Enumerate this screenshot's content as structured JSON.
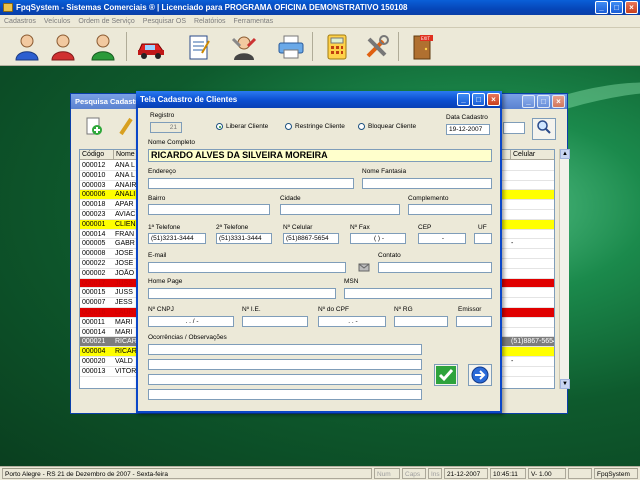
{
  "app": {
    "title": "FpqSystem - Sistemas Comerciais ® | Licenciado para PROGRAMA OFICINA DEMONSTRATIVO 150108",
    "menu": [
      "Cadastros",
      "Veículos",
      "Ordem de Serviço",
      "Pesquisar OS",
      "Relatórios",
      "Ferramentas"
    ],
    "toolbar_icons": [
      "user-blue-icon",
      "user-red-icon",
      "user-green-icon",
      "car-icon",
      "notepad-icon",
      "tools-person-icon",
      "printer-icon",
      "calculator-icon",
      "wrench-icon",
      "exit-icon"
    ]
  },
  "search_window": {
    "title": "Pesquisa Cadastro",
    "columns": [
      "Código",
      "Nome",
      "Celular"
    ],
    "rows": [
      {
        "code": "000012",
        "name": "ANA L",
        "cel": "",
        "style": ""
      },
      {
        "code": "000010",
        "name": "ANA L",
        "cel": "",
        "style": ""
      },
      {
        "code": "000003",
        "name": "ANAIR",
        "cel": "",
        "style": ""
      },
      {
        "code": "000006",
        "name": "ANALI",
        "cel": "",
        "style": "yellow"
      },
      {
        "code": "000018",
        "name": "APAR",
        "cel": "",
        "style": ""
      },
      {
        "code": "000023",
        "name": "AVIAC",
        "cel": "",
        "style": ""
      },
      {
        "code": "000001",
        "name": "CLIEN",
        "cel": "",
        "style": "yellow"
      },
      {
        "code": "000014",
        "name": "FRAN",
        "cel": "",
        "style": ""
      },
      {
        "code": "000005",
        "name": "GABR",
        "cel": "-",
        "style": ""
      },
      {
        "code": "000008",
        "name": "JOSE",
        "cel": "",
        "style": ""
      },
      {
        "code": "000022",
        "name": "JOSE",
        "cel": "",
        "style": ""
      },
      {
        "code": "000002",
        "name": "JOÃO",
        "cel": "",
        "style": ""
      },
      {
        "code": "000017",
        "name": "JUSS",
        "cel": "",
        "style": "red"
      },
      {
        "code": "000015",
        "name": "JUSS",
        "cel": "",
        "style": ""
      },
      {
        "code": "000007",
        "name": "JESS",
        "cel": "",
        "style": ""
      },
      {
        "code": "000016",
        "name": "LAUR",
        "cel": "",
        "style": "red"
      },
      {
        "code": "000011",
        "name": "MARI",
        "cel": "",
        "style": ""
      },
      {
        "code": "000014",
        "name": "MARI",
        "cel": "",
        "style": ""
      },
      {
        "code": "000021",
        "name": "RICAR",
        "cel": "(51)8867-5654",
        "style": "sel"
      },
      {
        "code": "000004",
        "name": "RICAR",
        "cel": "",
        "style": "yellow"
      },
      {
        "code": "000020",
        "name": "VALD",
        "cel": "-",
        "style": ""
      },
      {
        "code": "000013",
        "name": "VITOR",
        "cel": "",
        "style": ""
      }
    ]
  },
  "dialog": {
    "title": "Tela Cadastro de Clientes",
    "registro_label": "Registro",
    "registro_value": "21",
    "radios": [
      {
        "label": "Liberar Cliente",
        "checked": true
      },
      {
        "label": "Restringe Cliente",
        "checked": false
      },
      {
        "label": "Bloquear Cliente",
        "checked": false
      }
    ],
    "data_cadastro_label": "Data Cadastro",
    "data_cadastro_value": "19-12-2007",
    "nome_label": "Nome Completo",
    "nome_value": "RICARDO ALVES DA SILVEIRA MOREIRA",
    "endereco_label": "Endereço",
    "nome_fantasia_label": "Nome Fantasia",
    "bairro_label": "Bairro",
    "cidade_label": "Cidade",
    "complemento_label": "Complemento",
    "tel1_label": "1ª Telefone",
    "tel1_value": "(51)3231-3444",
    "tel2_label": "2ª Telefone",
    "tel2_value": "(51)3331-3444",
    "celular_label": "Nº Celular",
    "celular_value": "(51)8867-5654",
    "fax_label": "Nº Fax",
    "fax_value": "(  )   -",
    "cep_label": "CEP",
    "cep_value": "-",
    "uf_label": "UF",
    "email_label": "E-mail",
    "contato_label": "Contato",
    "homepage_label": "Home Page",
    "msn_label": "MSN",
    "cnpj_label": "Nº CNPJ",
    "cnpj_value": ". . / -",
    "ie_label": "Nº I.E.",
    "cpf_label": "Nº do CPF",
    "cpf_value": ". . -",
    "rg_label": "Nº RG",
    "emissor_label": "Emissor",
    "obs_label": "Ocorrências / Observações"
  },
  "status": {
    "location": "Porto Alegre - RS 21 de Dezembro de 2007 - Sexta-feira",
    "num": "Num",
    "caps": "Caps",
    "ins": "Ins",
    "date": "21-12-2007",
    "time": "10:45:11",
    "version": "V- 1.00",
    "app": "FpqSystem"
  }
}
